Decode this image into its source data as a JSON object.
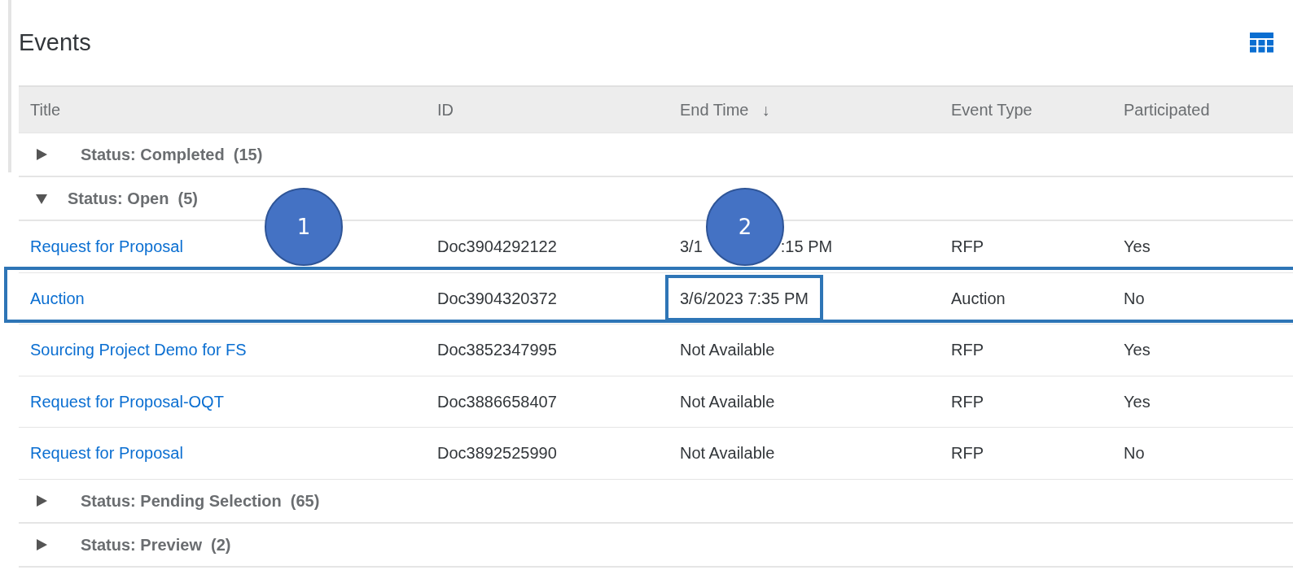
{
  "title": "Events",
  "columns": [
    {
      "label": "Title"
    },
    {
      "label": "ID"
    },
    {
      "label": "End Time",
      "sort_icon": "↓"
    },
    {
      "label": "Event Type"
    },
    {
      "label": "Participated"
    }
  ],
  "groups": [
    {
      "label": "Status: Completed  (15)",
      "expanded": false
    },
    {
      "label": "Status: Open  (5)",
      "expanded": true,
      "rows": [
        {
          "title": "Request for Proposal",
          "id": "Doc3904292122",
          "end_time_parts": [
            "3/1",
            ":15 PM"
          ],
          "event_type": "RFP",
          "participated": "Yes"
        },
        {
          "title": "Auction",
          "id": "Doc3904320372",
          "end_time": "3/6/2023 7:35 PM",
          "event_type": "Auction",
          "participated": "No",
          "highlighted": true
        },
        {
          "title": "Sourcing Project Demo for FS",
          "id": "Doc3852347995",
          "end_time": "Not Available",
          "event_type": "RFP",
          "participated": "Yes"
        },
        {
          "title": "Request for Proposal-OQT",
          "id": "Doc3886658407",
          "end_time": "Not Available",
          "event_type": "RFP",
          "participated": "Yes"
        },
        {
          "title": "Request for Proposal",
          "id": "Doc3892525990",
          "end_time": "Not Available",
          "event_type": "RFP",
          "participated": "No"
        }
      ]
    },
    {
      "label": "Status: Pending Selection  (65)",
      "expanded": false
    },
    {
      "label": "Status: Preview  (2)",
      "expanded": false
    }
  ],
  "callouts": [
    {
      "label": "1"
    },
    {
      "label": "2"
    }
  ]
}
